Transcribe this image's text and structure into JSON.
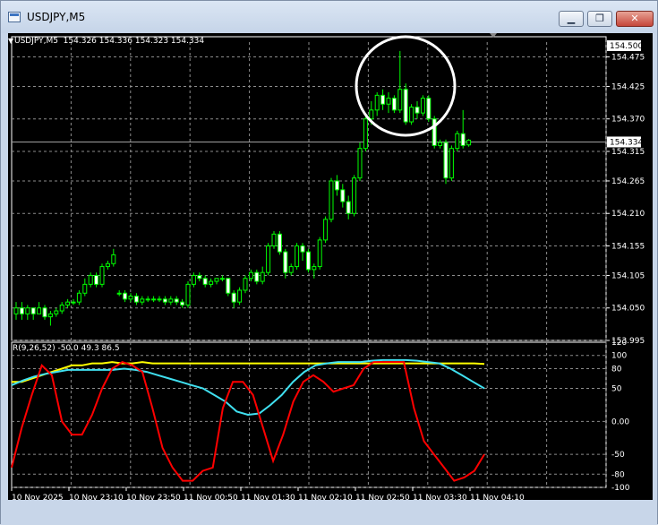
{
  "window": {
    "title": "USDJPY,M5",
    "minimize_label": "▁",
    "maximize_label": "❐",
    "close_label": "✕"
  },
  "main_pane": {
    "header": "USDJPY,M5  154.326 154.336 154.323 154.334",
    "current_price": "154.334",
    "top_price_box": "154.500",
    "price_ticks": [
      "154.475",
      "154.425",
      "154.370",
      "154.315",
      "154.265",
      "154.210",
      "154.155",
      "154.105",
      "154.050",
      "153.995"
    ]
  },
  "sub_pane": {
    "header": "R(9,26,52) -50.0 49.3 86.5",
    "ticks": [
      "120",
      "100",
      "80",
      "50",
      "0.00",
      "-50",
      "-80",
      "-100"
    ]
  },
  "time_axis": [
    "10 Nov 2025",
    "10 Nov 23:10",
    "10 Nov 23:50",
    "11 Nov 00:50",
    "11 Nov 01:30",
    "11 Nov 02:10",
    "11 Nov 02:50",
    "11 Nov 03:30",
    "11 Nov 04:10"
  ],
  "colors": {
    "bull": "#00ff00",
    "bear": "#ffffff",
    "red_line": "#ff0000",
    "yellow_line": "#ffff00",
    "cyan_line": "#40e0f0",
    "circle": "#ffffff",
    "grid": "#8c8c8c"
  },
  "chart_data": {
    "type": "candlestick",
    "price_range": [
      153.995,
      154.5
    ],
    "candles": [
      {
        "o": 154.04,
        "c": 154.05,
        "h": 154.06,
        "l": 154.03
      },
      {
        "o": 154.05,
        "c": 154.04,
        "h": 154.06,
        "l": 154.03
      },
      {
        "o": 154.04,
        "c": 154.05,
        "h": 154.055,
        "l": 154.03
      },
      {
        "o": 154.05,
        "c": 154.04,
        "h": 154.05,
        "l": 154.03
      },
      {
        "o": 154.04,
        "c": 154.05,
        "h": 154.06,
        "l": 154.04
      },
      {
        "o": 154.05,
        "c": 154.035,
        "h": 154.055,
        "l": 154.03
      },
      {
        "o": 154.035,
        "c": 154.04,
        "h": 154.045,
        "l": 154.02
      },
      {
        "o": 154.04,
        "c": 154.045,
        "h": 154.05,
        "l": 154.035
      },
      {
        "o": 154.045,
        "c": 154.055,
        "h": 154.06,
        "l": 154.04
      },
      {
        "o": 154.055,
        "c": 154.06,
        "h": 154.065,
        "l": 154.05
      },
      {
        "o": 154.06,
        "c": 154.06,
        "h": 154.065,
        "l": 154.055
      },
      {
        "o": 154.06,
        "c": 154.075,
        "h": 154.08,
        "l": 154.055
      },
      {
        "o": 154.075,
        "c": 154.09,
        "h": 154.1,
        "l": 154.07
      },
      {
        "o": 154.09,
        "c": 154.105,
        "h": 154.11,
        "l": 154.085
      },
      {
        "o": 154.105,
        "c": 154.09,
        "h": 154.11,
        "l": 154.085
      },
      {
        "o": 154.09,
        "c": 154.12,
        "h": 154.125,
        "l": 154.085
      },
      {
        "o": 154.12,
        "c": 154.125,
        "h": 154.13,
        "l": 154.115
      },
      {
        "o": 154.125,
        "c": 154.14,
        "h": 154.15,
        "l": 154.12
      },
      {
        "o": 154.075,
        "c": 154.075,
        "h": 154.08,
        "l": 154.07
      },
      {
        "o": 154.075,
        "c": 154.065,
        "h": 154.08,
        "l": 154.06
      },
      {
        "o": 154.065,
        "c": 154.07,
        "h": 154.075,
        "l": 154.06
      },
      {
        "o": 154.07,
        "c": 154.06,
        "h": 154.075,
        "l": 154.055
      },
      {
        "o": 154.06,
        "c": 154.065,
        "h": 154.07,
        "l": 154.055
      },
      {
        "o": 154.065,
        "c": 154.065,
        "h": 154.07,
        "l": 154.06
      },
      {
        "o": 154.065,
        "c": 154.065,
        "h": 154.07,
        "l": 154.06
      },
      {
        "o": 154.065,
        "c": 154.065,
        "h": 154.07,
        "l": 154.06
      },
      {
        "o": 154.065,
        "c": 154.06,
        "h": 154.07,
        "l": 154.055
      },
      {
        "o": 154.06,
        "c": 154.065,
        "h": 154.07,
        "l": 154.055
      },
      {
        "o": 154.065,
        "c": 154.06,
        "h": 154.07,
        "l": 154.055
      },
      {
        "o": 154.06,
        "c": 154.055,
        "h": 154.065,
        "l": 154.05
      },
      {
        "o": 154.055,
        "c": 154.09,
        "h": 154.095,
        "l": 154.05
      },
      {
        "o": 154.09,
        "c": 154.105,
        "h": 154.11,
        "l": 154.085
      },
      {
        "o": 154.105,
        "c": 154.1,
        "h": 154.11,
        "l": 154.095
      },
      {
        "o": 154.1,
        "c": 154.09,
        "h": 154.105,
        "l": 154.085
      },
      {
        "o": 154.09,
        "c": 154.095,
        "h": 154.1,
        "l": 154.085
      },
      {
        "o": 154.095,
        "c": 154.1,
        "h": 154.1,
        "l": 154.09
      },
      {
        "o": 154.1,
        "c": 154.1,
        "h": 154.105,
        "l": 154.095
      },
      {
        "o": 154.1,
        "c": 154.075,
        "h": 154.1,
        "l": 154.07
      },
      {
        "o": 154.075,
        "c": 154.06,
        "h": 154.08,
        "l": 154.05
      },
      {
        "o": 154.06,
        "c": 154.08,
        "h": 154.085,
        "l": 154.055
      },
      {
        "o": 154.08,
        "c": 154.1,
        "h": 154.105,
        "l": 154.075
      },
      {
        "o": 154.1,
        "c": 154.11,
        "h": 154.115,
        "l": 154.095
      },
      {
        "o": 154.11,
        "c": 154.095,
        "h": 154.115,
        "l": 154.09
      },
      {
        "o": 154.095,
        "c": 154.11,
        "h": 154.12,
        "l": 154.09
      },
      {
        "o": 154.11,
        "c": 154.155,
        "h": 154.16,
        "l": 154.105
      },
      {
        "o": 154.155,
        "c": 154.175,
        "h": 154.18,
        "l": 154.15
      },
      {
        "o": 154.175,
        "c": 154.145,
        "h": 154.18,
        "l": 154.14
      },
      {
        "o": 154.145,
        "c": 154.11,
        "h": 154.15,
        "l": 154.1
      },
      {
        "o": 154.11,
        "c": 154.12,
        "h": 154.125,
        "l": 154.105
      },
      {
        "o": 154.12,
        "c": 154.155,
        "h": 154.16,
        "l": 154.115
      },
      {
        "o": 154.155,
        "c": 154.145,
        "h": 154.16,
        "l": 154.13
      },
      {
        "o": 154.145,
        "c": 154.115,
        "h": 154.15,
        "l": 154.11
      },
      {
        "o": 154.115,
        "c": 154.12,
        "h": 154.125,
        "l": 154.1
      },
      {
        "o": 154.12,
        "c": 154.165,
        "h": 154.17,
        "l": 154.115
      },
      {
        "o": 154.165,
        "c": 154.2,
        "h": 154.205,
        "l": 154.16
      },
      {
        "o": 154.2,
        "c": 154.265,
        "h": 154.27,
        "l": 154.195
      },
      {
        "o": 154.265,
        "c": 154.25,
        "h": 154.275,
        "l": 154.24
      },
      {
        "o": 154.25,
        "c": 154.23,
        "h": 154.26,
        "l": 154.22
      },
      {
        "o": 154.23,
        "c": 154.21,
        "h": 154.24,
        "l": 154.2
      },
      {
        "o": 154.21,
        "c": 154.27,
        "h": 154.275,
        "l": 154.205
      },
      {
        "o": 154.27,
        "c": 154.32,
        "h": 154.33,
        "l": 154.265
      },
      {
        "o": 154.32,
        "c": 154.37,
        "h": 154.38,
        "l": 154.315
      },
      {
        "o": 154.37,
        "c": 154.385,
        "h": 154.4,
        "l": 154.36
      },
      {
        "o": 154.385,
        "c": 154.41,
        "h": 154.415,
        "l": 154.375
      },
      {
        "o": 154.41,
        "c": 154.395,
        "h": 154.42,
        "l": 154.385
      },
      {
        "o": 154.395,
        "c": 154.405,
        "h": 154.415,
        "l": 154.38
      },
      {
        "o": 154.405,
        "c": 154.385,
        "h": 154.41,
        "l": 154.38
      },
      {
        "o": 154.385,
        "c": 154.42,
        "h": 154.485,
        "l": 154.38
      },
      {
        "o": 154.42,
        "c": 154.365,
        "h": 154.43,
        "l": 154.36
      },
      {
        "o": 154.365,
        "c": 154.39,
        "h": 154.395,
        "l": 154.36
      },
      {
        "o": 154.39,
        "c": 154.38,
        "h": 154.4,
        "l": 154.37
      },
      {
        "o": 154.38,
        "c": 154.405,
        "h": 154.41,
        "l": 154.375
      },
      {
        "o": 154.405,
        "c": 154.37,
        "h": 154.41,
        "l": 154.365
      },
      {
        "o": 154.37,
        "c": 154.325,
        "h": 154.375,
        "l": 154.32
      },
      {
        "o": 154.325,
        "c": 154.33,
        "h": 154.335,
        "l": 154.32
      },
      {
        "o": 154.33,
        "c": 154.27,
        "h": 154.335,
        "l": 154.26
      },
      {
        "o": 154.27,
        "c": 154.32,
        "h": 154.325,
        "l": 154.265
      },
      {
        "o": 154.32,
        "c": 154.345,
        "h": 154.35,
        "l": 154.315
      },
      {
        "o": 154.345,
        "c": 154.325,
        "h": 154.385,
        "l": 154.32
      },
      {
        "o": 154.326,
        "c": 154.334,
        "h": 154.336,
        "l": 154.323
      }
    ],
    "indicator": {
      "name": "R(9,26,52)",
      "range": [
        -100,
        120
      ],
      "red": [
        -70,
        -10,
        40,
        85,
        70,
        0,
        -20,
        -20,
        10,
        50,
        80,
        90,
        85,
        75,
        20,
        -40,
        -70,
        -90,
        -90,
        -75,
        -70,
        20,
        60,
        60,
        40,
        -10,
        -60,
        -20,
        30,
        60,
        70,
        60,
        45,
        50,
        55,
        80,
        90,
        90,
        90,
        90,
        20,
        -30,
        -50,
        -70,
        -90,
        -85,
        -75,
        -50
      ],
      "yellow": [
        60,
        60,
        65,
        70,
        75,
        80,
        85,
        85,
        88,
        88,
        90,
        88,
        88,
        90,
        88,
        88,
        88,
        88,
        88,
        88,
        88,
        88,
        88,
        88,
        88,
        88,
        88,
        88,
        88,
        88,
        88,
        88,
        88,
        88,
        88,
        88,
        88,
        88,
        88,
        88,
        88,
        88,
        88,
        88,
        88,
        88,
        88,
        87
      ],
      "cyan": [
        55,
        62,
        68,
        72,
        75,
        78,
        78,
        78,
        78,
        78,
        80,
        78,
        75,
        70,
        65,
        60,
        55,
        50,
        40,
        30,
        15,
        10,
        12,
        25,
        40,
        60,
        75,
        85,
        88,
        90,
        90,
        90,
        92,
        93,
        93,
        93,
        92,
        90,
        88,
        80,
        70,
        60,
        50
      ]
    }
  }
}
